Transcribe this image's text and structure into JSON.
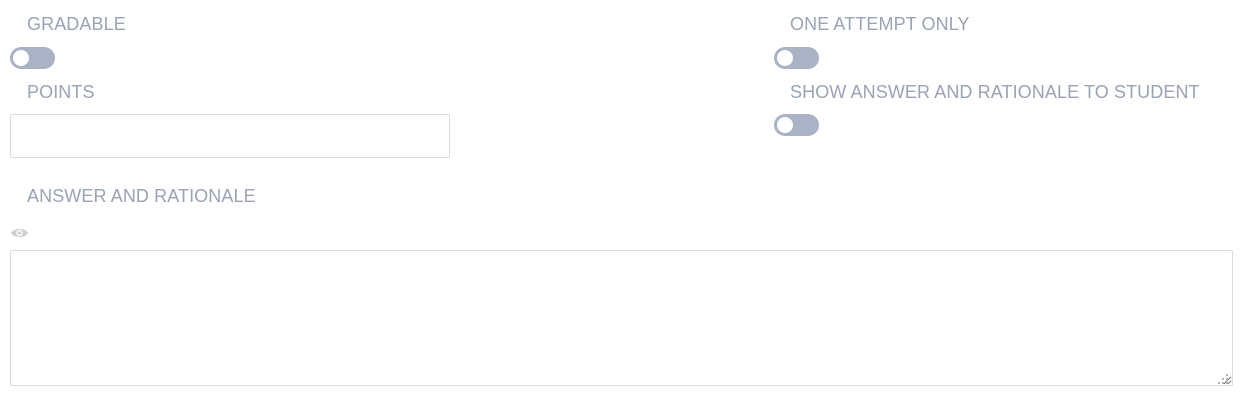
{
  "gradable": {
    "label": "GRADABLE",
    "enabled": false
  },
  "one_attempt_only": {
    "label": "ONE ATTEMPT ONLY",
    "enabled": false
  },
  "points": {
    "label": "POINTS",
    "value": "",
    "placeholder": ""
  },
  "show_answer": {
    "label": "SHOW ANSWER AND RATIONALE TO STUDENT",
    "enabled": false
  },
  "answer_rationale": {
    "label": "ANSWER AND RATIONALE",
    "value": "",
    "preview_icon": "eye-icon"
  },
  "colors": {
    "label_text": "#9aa3b6",
    "toggle_off": "#aab2c5",
    "border": "#dcdcdc"
  }
}
